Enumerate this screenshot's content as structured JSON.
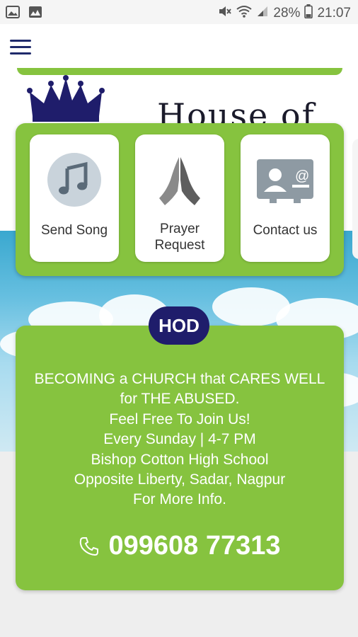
{
  "status_bar": {
    "battery": "28%",
    "time": "21:07"
  },
  "actions": [
    {
      "label": "Send Song",
      "icon": "music-note-icon"
    },
    {
      "label_line1": "Prayer",
      "label_line2": "Request",
      "icon": "praying-hands-icon"
    },
    {
      "label": "Contact us",
      "icon": "contact-card-icon"
    }
  ],
  "header": {
    "brand_partial": "House of"
  },
  "info": {
    "badge": "HOD",
    "lines": [
      "BECOMING a CHURCH that CARES WELL",
      "for THE ABUSED.",
      "Feel Free To Join Us!",
      "Every Sunday | 4-7 PM",
      "Bishop Cotton High School",
      "Opposite Liberty, Sadar, Nagpur",
      "For More Info."
    ],
    "phone": "099608 77313"
  },
  "colors": {
    "accent_green": "#86c33f",
    "navy": "#1f1d6b",
    "sky_blue": "#3aa8cf"
  }
}
